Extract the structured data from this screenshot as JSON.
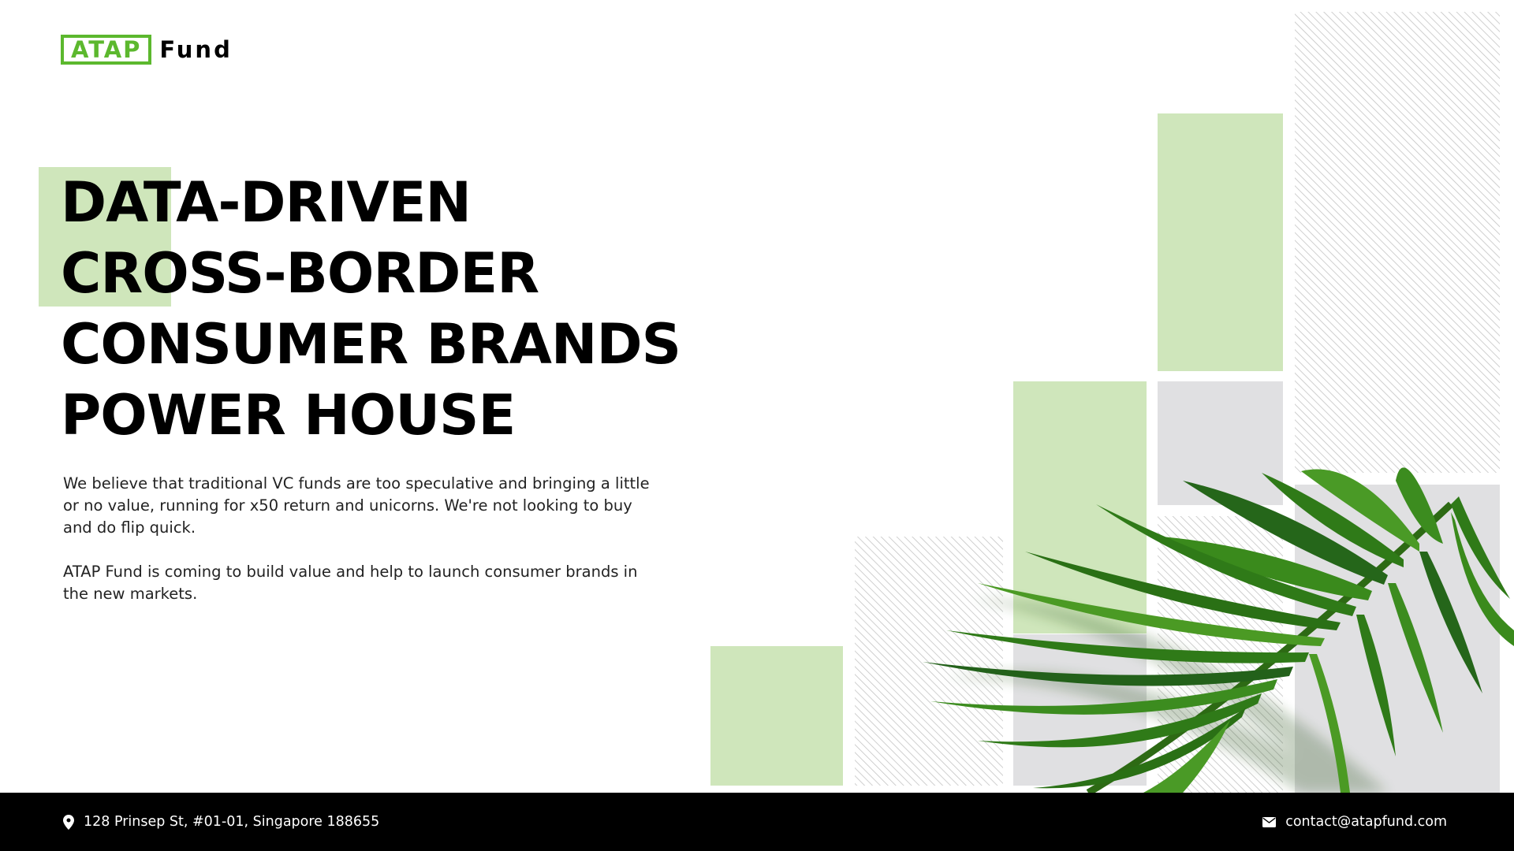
{
  "header": {
    "logo_box_text": "ATAP",
    "logo_word": "Fund"
  },
  "hero": {
    "title_lines": [
      "DATA-DRIVEN",
      "CROSS-BORDER",
      "CONSUMER BRANDS",
      "POWER HOUSE"
    ],
    "paragraphs": [
      "We believe that traditional VC funds are too speculative and bringing a little or no value, running for x50 return and unicorns. We're not looking to buy and do flip quick.",
      "ATAP Fund is coming to build value and help to launch consumer brands in the new markets."
    ]
  },
  "footer": {
    "address_icon": "map-pin-icon",
    "address": "128 Prinsep St, #01-01, Singapore 188655",
    "email_icon": "envelope-icon",
    "email": "contact@atapfund.com"
  },
  "colors": {
    "brand_green": "#5cb82e",
    "light_green": "#cfe6bb",
    "light_gray": "#e0e0e2",
    "footer_bg": "#000000"
  }
}
